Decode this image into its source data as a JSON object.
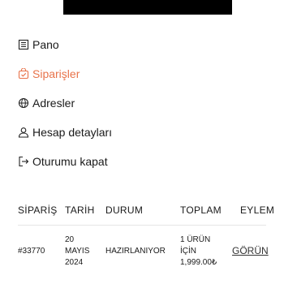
{
  "menu": {
    "items": [
      {
        "label": "Pano",
        "icon": "dashboard-icon"
      },
      {
        "label": "Siparişler",
        "icon": "shopping-bag-icon",
        "active": true
      },
      {
        "label": "Adresler",
        "icon": "globe-icon"
      },
      {
        "label": "Hesap detayları",
        "icon": "user-icon"
      },
      {
        "label": "Oturumu kapat",
        "icon": "logout-icon"
      }
    ],
    "active_color": "#e8734a"
  },
  "orders": {
    "headers": {
      "order": "SİPARİŞ",
      "date": "TARİH",
      "status": "DURUM",
      "total": "TOPLAM",
      "actions": "EYLEM"
    },
    "rows": [
      {
        "order": "#33770",
        "date": "20\nMAYIS\n2024",
        "status": "HAZIRLANIYOR",
        "total": "1 ÜRÜN\nİÇİN\n1,999.00₺",
        "action": "GÖRÜN"
      }
    ]
  }
}
